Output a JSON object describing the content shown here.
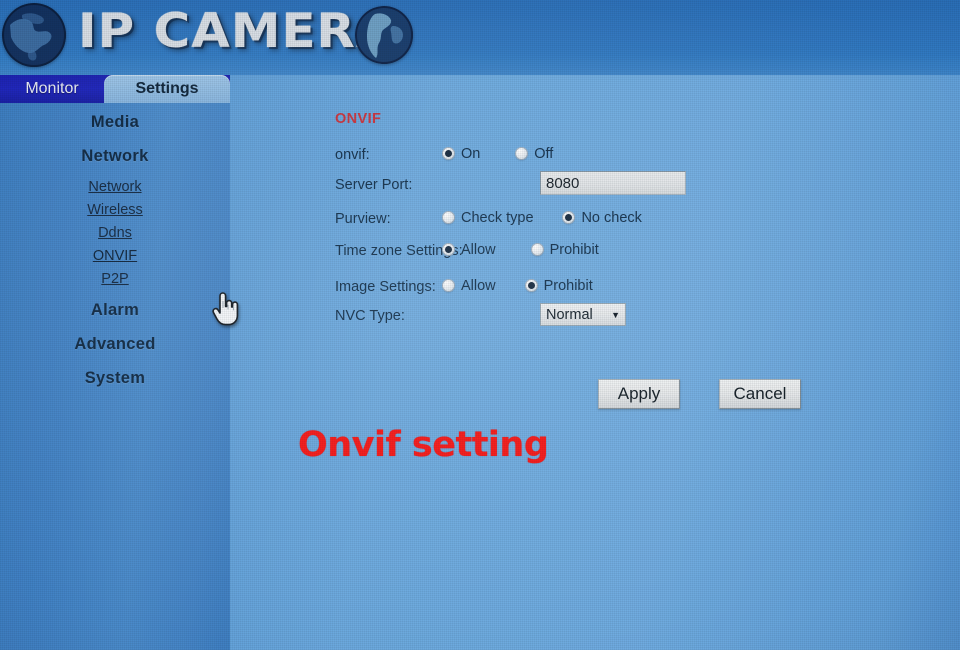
{
  "header": {
    "logo_text": "IP CAMERA",
    "globe_left_icon": "globe-icon",
    "globe_right_icon": "globe-icon"
  },
  "tabs": [
    {
      "id": "monitor",
      "label": "Monitor",
      "active": false
    },
    {
      "id": "settings",
      "label": "Settings",
      "active": true
    }
  ],
  "sidebar": {
    "groups": [
      {
        "id": "media",
        "label": "Media"
      },
      {
        "id": "network",
        "label": "Network"
      },
      {
        "id": "alarm",
        "label": "Alarm"
      },
      {
        "id": "advanced",
        "label": "Advanced"
      },
      {
        "id": "system",
        "label": "System"
      }
    ],
    "network_subitems": [
      {
        "id": "network",
        "label": "Network",
        "active": false
      },
      {
        "id": "wireless",
        "label": "Wireless",
        "active": false
      },
      {
        "id": "ddns",
        "label": "Ddns",
        "active": false
      },
      {
        "id": "onvif",
        "label": "ONVIF",
        "active": true
      },
      {
        "id": "p2p",
        "label": "P2P",
        "active": false
      }
    ]
  },
  "content": {
    "section_title": "ONVIF",
    "rows": {
      "onvif": {
        "label": "onvif:",
        "options": [
          {
            "label": "On",
            "checked": true
          },
          {
            "label": "Off",
            "checked": false
          }
        ]
      },
      "server_port": {
        "label": "Server Port:",
        "value": "8080",
        "placeholder": ""
      },
      "purview": {
        "label": "Purview:",
        "options": [
          {
            "label": "Check type",
            "checked": false
          },
          {
            "label": "No check",
            "checked": true
          }
        ]
      },
      "time_zone": {
        "label": "Time zone Settings:",
        "options": [
          {
            "label": "Allow",
            "checked": true
          },
          {
            "label": "Prohibit",
            "checked": false
          }
        ]
      },
      "image_settings": {
        "label": "Image Settings:",
        "options": [
          {
            "label": "Allow",
            "checked": false
          },
          {
            "label": "Prohibit",
            "checked": true
          }
        ]
      },
      "nvc_type": {
        "label": "NVC Type:",
        "value": "Normal",
        "arrow": "▼",
        "options": [
          "Normal"
        ]
      }
    },
    "buttons": {
      "apply": "Apply",
      "cancel": "Cancel"
    }
  },
  "annotation": {
    "text": "Onvif setting",
    "color": "#f51212"
  },
  "cursor": {
    "icon": "pointing-hand-cursor"
  },
  "colors": {
    "header_blue": "#2e74bd",
    "tabbar_blue": "#1d24bb",
    "sidebar_blue": "#4182c5",
    "content_blue": "#6aa8de",
    "section_title_red": "#c7303a",
    "annotation_red": "#f51212"
  }
}
